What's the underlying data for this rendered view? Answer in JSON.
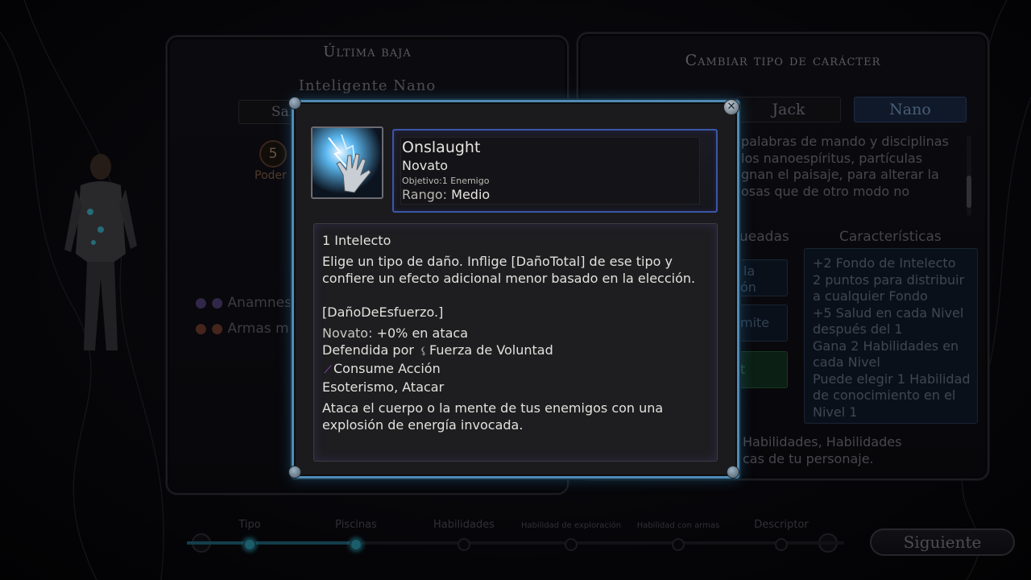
{
  "left_panel": {
    "title": "Última baja",
    "subtitle": "Inteligente Nano",
    "tab_partial": "Salu",
    "stat_value": "5",
    "stat_label": "Poder",
    "list_item_1": "Anamnes",
    "list_item_2": "Armas m"
  },
  "right_panel": {
    "title": "Cambiar tipo de carácter",
    "type_jack": "Jack",
    "type_nano": "Nano",
    "description_lines": [
      "palabras de mando y disciplinas",
      "los nanoespíritus, partículas",
      "gnan el paisaje, para alterar la",
      "osas que de otro modo no"
    ],
    "unlocked_header_partial": "ueadas",
    "features_header": "Características",
    "features": [
      "+2 Fondo de Intelecto",
      "2 puntos para distribuir",
      "a cualquier Fondo",
      "+5 Salud en cada Nivel",
      "después del 1",
      "Gana 2 Habilidades en",
      "cada Nivel",
      "Puede elegir 1 Habilidad",
      "de conocimiento en el",
      "Nivel 1"
    ],
    "mid_partials": [
      "la",
      "ón",
      "mite",
      "t"
    ],
    "footer_line_1": "Habilidades, Habilidades",
    "footer_line_2": "cas de tu personaje."
  },
  "nav": {
    "steps": [
      {
        "label": "Tipo",
        "active": true
      },
      {
        "label": "Piscinas",
        "active": true
      },
      {
        "label": "Habilidades",
        "active": false
      },
      {
        "label": "Habilidad de exploración",
        "active": false
      },
      {
        "label": "Habilidad con armas",
        "active": false
      },
      {
        "label": "Descriptor",
        "active": false
      }
    ],
    "progress_fraction": 0.25,
    "next_label": "Siguiente"
  },
  "tooltip": {
    "close_icon": "close-icon",
    "ability_name": "Onslaught",
    "tier": "Novato",
    "target_key": "Objetivo:",
    "target_value": "1 Enemigo",
    "range_key": "Rango:",
    "range_value": "Medio",
    "cost": "1 Intelecto",
    "description": "Elige un tipo de daño. Inflige [DañoTotal] de ese tipo y confiere un efecto adicional menor basado en la elección.",
    "effort_tag": "[DañoDeEsfuerzo.]",
    "novato_key": "Novato:",
    "novato_value": "+0% en ataca",
    "defended_key": "Defendida por",
    "defended_value": "Fuerza de Voluntad",
    "action_text": "Consume Acción",
    "tags": "Esoterismo, Atacar",
    "flavor": "Ataca el cuerpo o la mente de tus enemigos con una explosión de energía invocada.",
    "colors": {
      "frame": "#4f8bb6",
      "header_border": "#3b56a8",
      "action_glyph": "#a24bdc"
    }
  }
}
